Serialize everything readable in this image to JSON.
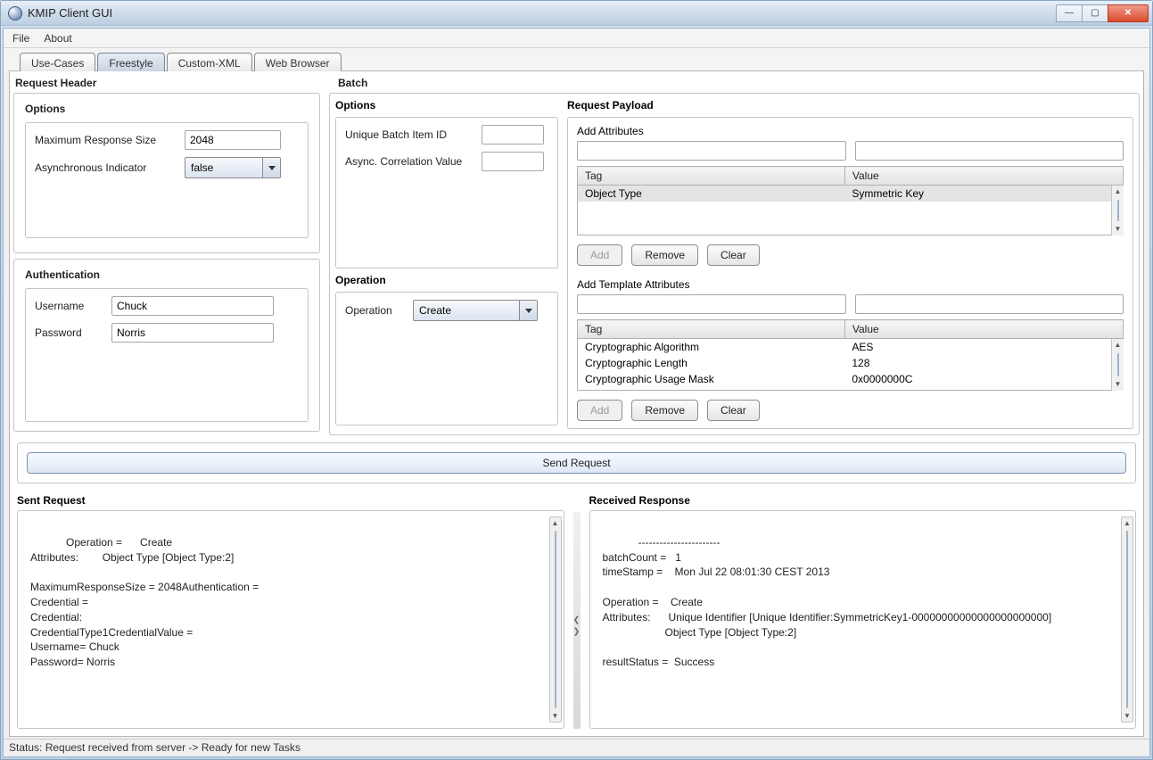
{
  "window": {
    "title": "KMIP Client GUI"
  },
  "menu": {
    "file": "File",
    "about": "About"
  },
  "tabs": {
    "use_cases": "Use-Cases",
    "freestyle": "Freestyle",
    "custom_xml": "Custom-XML",
    "web_browser": "Web Browser"
  },
  "sections": {
    "request_header": "Request Header",
    "batch": "Batch",
    "options": "Options",
    "authentication": "Authentication",
    "operation": "Operation",
    "request_payload": "Request Payload",
    "sent_request": "Sent Request",
    "received_response": "Received Response",
    "add_attributes": "Add Attributes",
    "add_template_attributes": "Add Template Attributes"
  },
  "req_header": {
    "max_response_size_label": "Maximum Response Size",
    "max_response_size_value": "2048",
    "async_indicator_label": "Asynchronous Indicator",
    "async_indicator_value": "false"
  },
  "auth": {
    "username_label": "Username",
    "username_value": "Chuck",
    "password_label": "Password",
    "password_value": "Norris"
  },
  "batch_options": {
    "unique_id_label": "Unique Batch Item ID",
    "unique_id_value": "",
    "async_corr_label": "Async. Correlation Value",
    "async_corr_value": ""
  },
  "operation": {
    "label": "Operation",
    "value": "Create"
  },
  "attr_table": {
    "tag_header": "Tag",
    "value_header": "Value",
    "rows": [
      {
        "tag": "Object Type",
        "value": "Symmetric Key"
      }
    ]
  },
  "tmpl_table": {
    "tag_header": "Tag",
    "value_header": "Value",
    "rows": [
      {
        "tag": "Cryptographic Algorithm",
        "value": "AES"
      },
      {
        "tag": "Cryptographic Length",
        "value": "128"
      },
      {
        "tag": "Cryptographic Usage Mask",
        "value": "0x0000000C"
      }
    ]
  },
  "buttons": {
    "add": "Add",
    "remove": "Remove",
    "clear": "Clear",
    "send_request": "Send Request"
  },
  "sent_request_text": "Operation =      Create\nAttributes:        Object Type [Object Type:2]\n\nMaximumResponseSize = 2048Authentication =\nCredential =\nCredential:\nCredentialType1CredentialValue =\nUsername= Chuck\nPassword= Norris",
  "received_response_text": "-----------------------\nbatchCount =   1\ntimeStamp =    Mon Jul 22 08:01:30 CEST 2013\n\nOperation =    Create\nAttributes:      Unique Identifier [Unique Identifier:SymmetricKey1-00000000000000000000000]\n                     Object Type [Object Type:2]\n\nresultStatus =  Success",
  "status": "Status: Request received from server -> Ready for new Tasks"
}
